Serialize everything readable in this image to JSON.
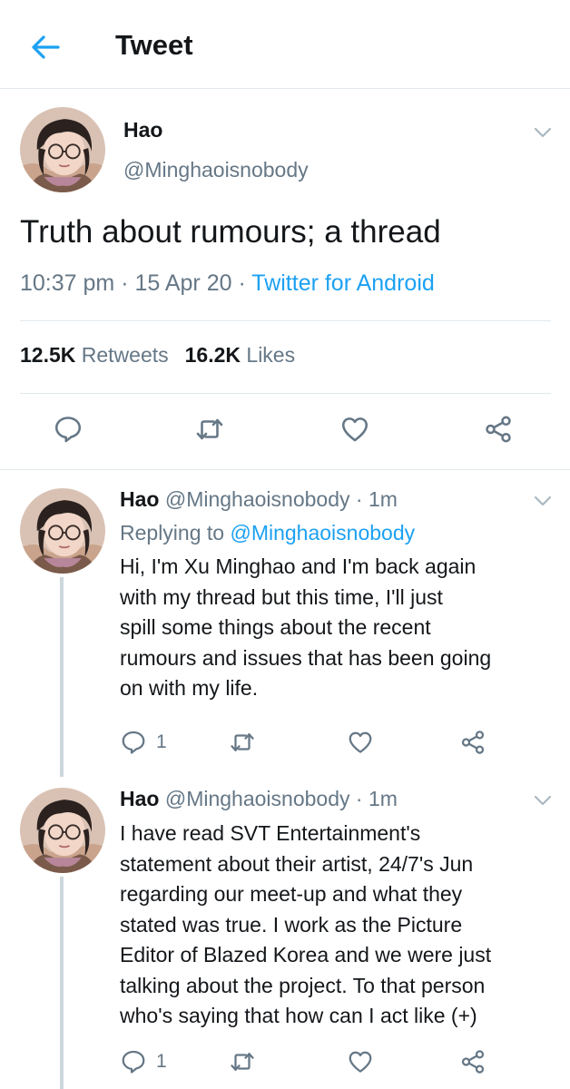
{
  "header": {
    "title": "Tweet"
  },
  "main_tweet": {
    "name": "Hao",
    "handle": "@Minghaoisnobody",
    "text": "Truth about rumours; a thread",
    "time": "10:37 pm",
    "date": "15 Apr 20",
    "client": "Twitter for Android",
    "sep": "·",
    "retweets_count": "12.5K",
    "retweets_label": "Retweets",
    "likes_count": "16.2K",
    "likes_label": "Likes"
  },
  "replies": [
    {
      "name": "Hao",
      "handle": "@Minghaoisnobody",
      "time": "· 1m",
      "replying_label": "Replying to",
      "replying_to": "@Minghaoisnobody",
      "lines": [
        "Hi, I'm Xu Minghao and I'm back again",
        "with my thread but this time, I'll just",
        "spill some things about the recent",
        "rumours and issues that has been going",
        "on with my life."
      ],
      "reply_count": "1"
    },
    {
      "name": "Hao",
      "handle": "@Minghaoisnobody",
      "time": "· 1m",
      "lines": [
        "I have read SVT Entertainment's",
        "statement about their artist, 24/7's Jun",
        "regarding our meet-up and what they",
        "stated was true. I work as the Picture",
        "Editor of Blazed Korea and we were just",
        "talking about the project. To that person",
        "who's saying that how can I act like (+)"
      ],
      "reply_count": "1"
    }
  ],
  "icons": {
    "back": "arrow-left-icon",
    "caret": "chevron-down-icon",
    "reply": "comment-icon",
    "retweet": "retweet-icon",
    "like": "heart-icon",
    "share": "share-icon"
  },
  "colors": {
    "accent": "#1da1f2",
    "secondary_text": "#657786",
    "divider": "#e1e8ed",
    "thread_line": "#ccd6dd"
  }
}
